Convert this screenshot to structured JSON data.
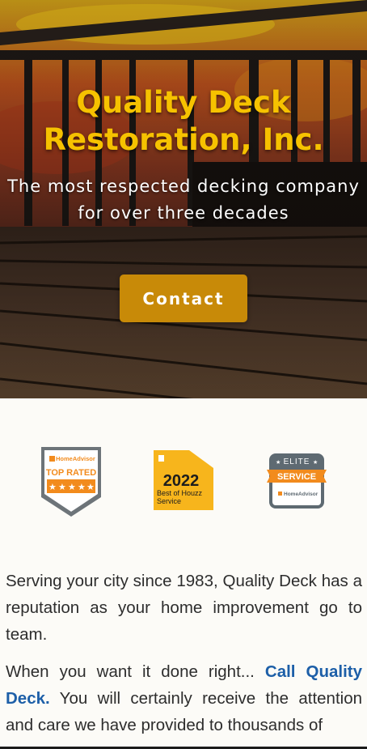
{
  "hero": {
    "title_line1": "Quality Deck",
    "title_line2": "Restoration, Inc.",
    "subtitle_line1": "The most respected decking company",
    "subtitle_line2": "for over three decades",
    "contact_label": "Contact"
  },
  "badges": {
    "home_advisor_top": {
      "brand": "HomeAdvisor",
      "label": "TOP RATED",
      "stars": 5
    },
    "houzz": {
      "year": "2022",
      "line1": "Best of Houzz",
      "line2": "Service"
    },
    "elite": {
      "top": "ELITE",
      "ribbon": "SERVICE",
      "brand": "HomeAdvisor"
    }
  },
  "content": {
    "paragraph1": "Serving your city since 1983, Quality Deck has a reputation as your home improvement go to team.",
    "paragraph2_before": "When you want it done right... ",
    "paragraph2_link": "Call Quality Deck.",
    "paragraph2_after": " You will certainly receive the attention and care we have provided to thousands of"
  },
  "colors": {
    "title_gold": "#f6c200",
    "button_gold": "#c88a08",
    "link_blue": "#1d5fa8",
    "page_bg": "#fcfbf7"
  }
}
